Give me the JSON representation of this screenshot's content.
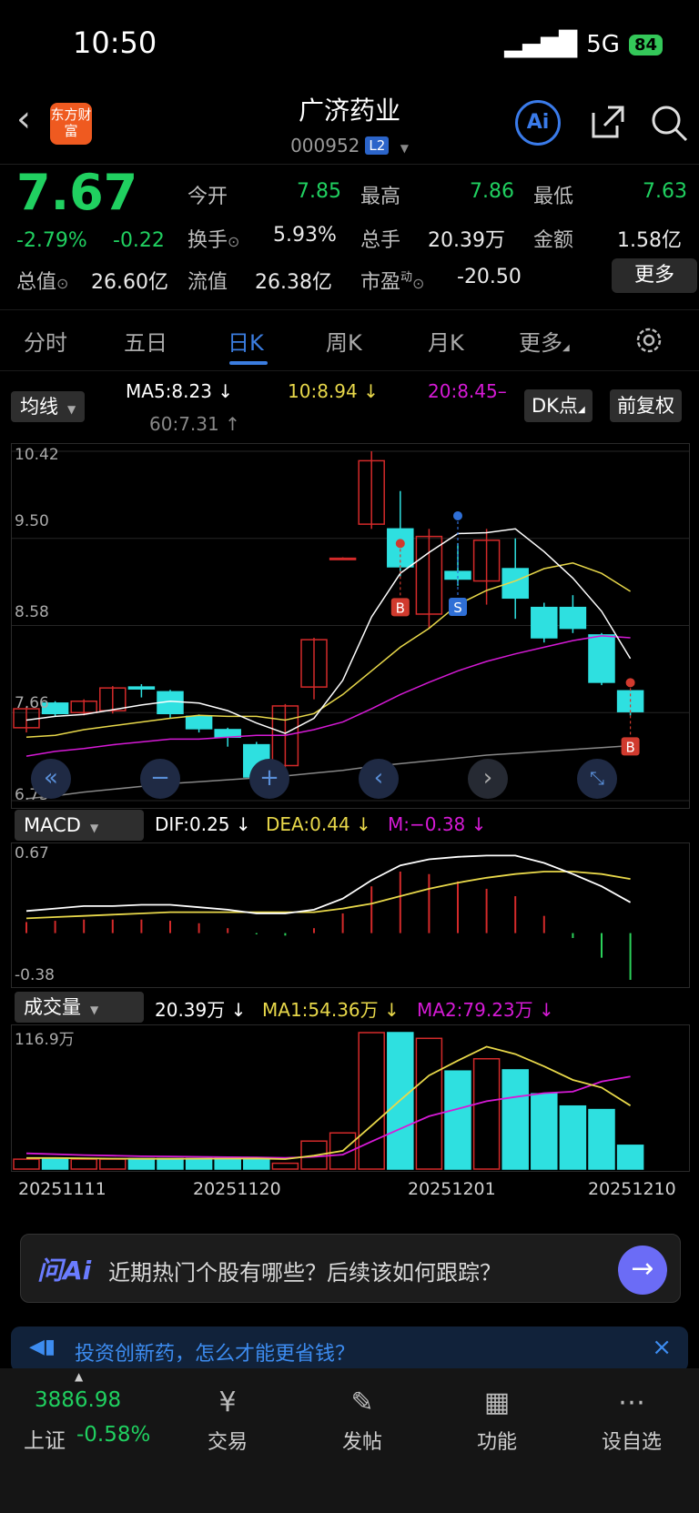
{
  "status_bar": {
    "time": "10:50",
    "network": "5G",
    "battery": "84"
  },
  "header": {
    "logo": "东方财富",
    "title": "广济药业",
    "code": "000952",
    "level": "L2",
    "ai_label": "Ai"
  },
  "quote": {
    "price": "7.67",
    "change_pct": "-2.79%",
    "change": "-0.22",
    "rows": [
      [
        {
          "label": "今开",
          "value": "7.85"
        },
        {
          "label": "最高",
          "value": "7.86"
        },
        {
          "label": "最低",
          "value": "7.63"
        }
      ],
      [
        {
          "label": "换手",
          "value": "5.93%"
        },
        {
          "label": "总手",
          "value": "20.39万"
        },
        {
          "label": "金额",
          "value": "1.58亿"
        }
      ],
      [
        {
          "label": "总值",
          "value": "26.60亿"
        },
        {
          "label": "流值",
          "value": "26.38亿"
        },
        {
          "label": "市盈",
          "value": "-20.50",
          "sup": "动"
        }
      ]
    ],
    "more": "更多"
  },
  "tabs": [
    "分时",
    "五日",
    "日K",
    "周K",
    "月K",
    "更多"
  ],
  "active_tab": "日K",
  "ma_bar": {
    "selector": "均线",
    "ma5": "MA5:8.23 ↓",
    "ma10": "10:8.94 ↓",
    "ma20": "20:8.45–",
    "ma60": "60:7.31 ↑",
    "dk_btn": "DK点",
    "fq_btn": "前复权"
  },
  "price_axis": [
    "10.42",
    "9.50",
    "8.58",
    "7.66",
    "6.73"
  ],
  "signals": {
    "buy": "B",
    "sell": "S"
  },
  "macd_bar": {
    "selector": "MACD",
    "dif": "DIF:0.25 ↓",
    "dea": "DEA:0.44 ↓",
    "m": "M:−0.38 ↓",
    "top": "0.67",
    "bottom": "-0.38"
  },
  "vol_bar": {
    "selector": "成交量",
    "vol": "20.39万 ↓",
    "ma1": "MA1:54.36万 ↓",
    "ma2": "MA2:79.23万 ↓",
    "top": "116.9万"
  },
  "dates": [
    "20251111",
    "20251120",
    "20251201",
    "20251210"
  ],
  "ai_bar": {
    "logo": "问Ai",
    "text": "近期热门个股有哪些？后续该如何跟踪？"
  },
  "banner": {
    "text": "投资创新药，怎么才能更省钱？"
  },
  "bottom_nav": {
    "index_value": "3886.98",
    "index_name": "上证",
    "index_change": "-0.58%",
    "items": [
      {
        "label": "交易",
        "icon": "yen-icon"
      },
      {
        "label": "发帖",
        "icon": "edit-icon"
      },
      {
        "label": "功能",
        "icon": "grid-icon"
      },
      {
        "label": "设自选",
        "icon": "more-icon"
      }
    ]
  },
  "colors": {
    "up": "#d42a2a",
    "down": "#2ee0e0",
    "ma5": "#ffffff",
    "ma10": "#e8d84a",
    "ma20": "#d61ad6",
    "ma60": "#888888",
    "accent": "#3b7de0"
  },
  "chart_data": [
    {
      "type": "candlestick",
      "title": "日K",
      "ylim": [
        6.73,
        10.42
      ],
      "y_ticks": [
        10.42,
        9.5,
        8.58,
        7.66,
        6.73
      ],
      "candles": [
        {
          "o": 7.5,
          "c": 7.7,
          "h": 7.72,
          "l": 7.45
        },
        {
          "o": 7.76,
          "c": 7.65,
          "h": 7.78,
          "l": 7.62
        },
        {
          "o": 7.66,
          "c": 7.78,
          "h": 7.8,
          "l": 7.63
        },
        {
          "o": 7.68,
          "c": 7.92,
          "h": 7.94,
          "l": 7.65
        },
        {
          "o": 7.93,
          "c": 7.91,
          "h": 7.96,
          "l": 7.82
        },
        {
          "o": 7.88,
          "c": 7.65,
          "h": 7.9,
          "l": 7.6
        },
        {
          "o": 7.62,
          "c": 7.49,
          "h": 7.64,
          "l": 7.45
        },
        {
          "o": 7.48,
          "c": 7.4,
          "h": 7.5,
          "l": 7.3
        },
        {
          "o": 7.32,
          "c": 6.98,
          "h": 7.35,
          "l": 6.85
        },
        {
          "o": 7.1,
          "c": 7.73,
          "h": 7.75,
          "l": 7.05
        },
        {
          "o": 7.93,
          "c": 8.43,
          "h": 8.45,
          "l": 7.8
        },
        {
          "o": 9.29,
          "c": 9.29,
          "h": 9.3,
          "l": 9.28
        },
        {
          "o": 9.65,
          "c": 10.32,
          "h": 10.42,
          "l": 9.6
        },
        {
          "o": 9.6,
          "c": 9.2,
          "h": 10.0,
          "l": 9.1
        },
        {
          "o": 8.7,
          "c": 9.52,
          "h": 9.6,
          "l": 8.55
        },
        {
          "o": 9.15,
          "c": 9.07,
          "h": 9.45,
          "l": 9.0
        },
        {
          "o": 9.05,
          "c": 9.48,
          "h": 9.6,
          "l": 8.8
        },
        {
          "o": 9.18,
          "c": 8.87,
          "h": 9.5,
          "l": 8.65
        },
        {
          "o": 8.77,
          "c": 8.45,
          "h": 8.82,
          "l": 8.4
        },
        {
          "o": 8.77,
          "c": 8.55,
          "h": 8.9,
          "l": 8.5
        },
        {
          "o": 8.48,
          "c": 7.98,
          "h": 8.5,
          "l": 7.95
        },
        {
          "o": 7.89,
          "c": 7.67,
          "h": 7.9,
          "l": 7.63
        }
      ],
      "ma5": [
        7.58,
        7.62,
        7.64,
        7.69,
        7.74,
        7.78,
        7.76,
        7.68,
        7.55,
        7.44,
        7.6,
        8.0,
        8.67,
        9.13,
        9.35,
        9.55,
        9.56,
        9.6,
        9.36,
        9.08,
        8.73,
        8.23
      ],
      "ma10": [
        7.4,
        7.42,
        7.48,
        7.52,
        7.56,
        7.6,
        7.63,
        7.62,
        7.62,
        7.58,
        7.65,
        7.85,
        8.1,
        8.35,
        8.55,
        8.8,
        8.95,
        9.05,
        9.18,
        9.24,
        9.13,
        8.94
      ],
      "ma20": [
        7.2,
        7.25,
        7.28,
        7.32,
        7.35,
        7.38,
        7.38,
        7.4,
        7.42,
        7.42,
        7.48,
        7.56,
        7.7,
        7.85,
        7.98,
        8.1,
        8.2,
        8.28,
        8.35,
        8.42,
        8.47,
        8.45
      ],
      "ma60": [
        6.75,
        6.78,
        6.82,
        6.85,
        6.88,
        6.91,
        6.93,
        6.95,
        6.97,
        6.99,
        7.02,
        7.05,
        7.09,
        7.12,
        7.15,
        7.18,
        7.21,
        7.23,
        7.25,
        7.27,
        7.29,
        7.31
      ],
      "signals": [
        {
          "index": 13,
          "type": "B"
        },
        {
          "index": 15,
          "type": "S"
        },
        {
          "index": 21,
          "type": "B"
        }
      ]
    },
    {
      "type": "line",
      "title": "MACD",
      "ylim": [
        -0.38,
        0.67
      ],
      "dif": [
        0.18,
        0.2,
        0.22,
        0.22,
        0.23,
        0.23,
        0.21,
        0.19,
        0.16,
        0.16,
        0.19,
        0.28,
        0.43,
        0.55,
        0.6,
        0.62,
        0.63,
        0.63,
        0.57,
        0.48,
        0.38,
        0.25
      ],
      "dea": [
        0.12,
        0.13,
        0.14,
        0.15,
        0.16,
        0.17,
        0.17,
        0.17,
        0.17,
        0.17,
        0.17,
        0.2,
        0.24,
        0.3,
        0.36,
        0.41,
        0.45,
        0.48,
        0.5,
        0.5,
        0.48,
        0.44
      ],
      "m": [
        0.09,
        0.1,
        0.11,
        0.11,
        0.11,
        0.1,
        0.08,
        0.04,
        -0.01,
        -0.02,
        0.04,
        0.16,
        0.38,
        0.5,
        0.48,
        0.42,
        0.36,
        0.3,
        0.14,
        -0.04,
        -0.2,
        -0.38
      ]
    },
    {
      "type": "bar",
      "title": "成交量",
      "ylim": [
        0,
        116.9
      ],
      "values": [
        8.5,
        9.5,
        8.5,
        8.5,
        9.0,
        9.0,
        9.0,
        9.0,
        9.5,
        5.0,
        24.0,
        31.0,
        116.9,
        116.9,
        112.0,
        84.0,
        94.5,
        85.0,
        64.5,
        54.0,
        51.0,
        20.39
      ],
      "ma1": [
        9.5,
        9.5,
        9.2,
        9.0,
        8.8,
        8.8,
        8.9,
        9.0,
        9.1,
        8.6,
        11.5,
        15.7,
        37.2,
        59.1,
        80.2,
        92.9,
        104.9,
        98.5,
        88.0,
        76.4,
        69.8,
        54.36
      ],
      "ma2": [
        13.5,
        12.8,
        12.0,
        11.5,
        11.0,
        10.8,
        10.5,
        10.2,
        10.0,
        9.6,
        10.5,
        12.4,
        23.6,
        34.5,
        45.3,
        51.6,
        58.1,
        61.8,
        65.1,
        66.3,
        75.0,
        79.23
      ]
    }
  ]
}
